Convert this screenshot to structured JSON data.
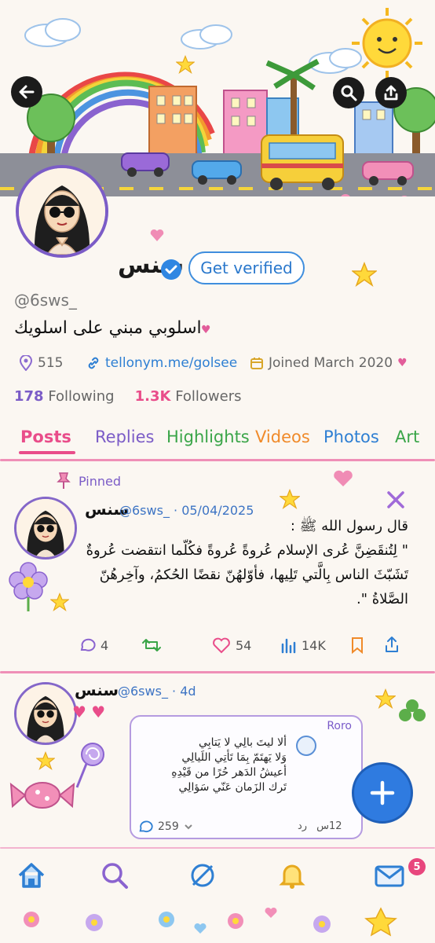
{
  "profile": {
    "display_name": "سنس",
    "get_verified_label": "Get verified",
    "handle": "@6sws_",
    "bio": "اسلوبي مبني على اسلويك",
    "location": "515",
    "website": "tellonym.me/golsee",
    "joined": "Joined March 2020",
    "following_count": "178",
    "following_label": "Following",
    "followers_count": "1.3K",
    "followers_label": "Followers"
  },
  "tabs": [
    {
      "label": "Posts",
      "color": "#e94d8a"
    },
    {
      "label": "Replies",
      "color": "#7b5cc7"
    },
    {
      "label": "Highlights",
      "color": "#3aa548"
    },
    {
      "label": "Videos",
      "color": "#f08a2a"
    },
    {
      "label": "Photos",
      "color": "#2e7fd3"
    },
    {
      "label": "Art",
      "color": "#3aa548"
    }
  ],
  "pinned_post": {
    "pinned_label": "Pinned",
    "name": "سنس",
    "handle_date": "@6sws_ · 05/04/2025",
    "lines": [
      "قال رسول الله ﷺ :",
      "\" لِتُنقَضِنَّ عُرى الإسلام عُروةً عُروةً فكُلّما انتقضت عُروةٌ",
      "تَشَبّثَ الناس بِالَّتي تَلِيها، فأوّلهُنّ نقضًا الحُكمُ، وآخِرهُنّ",
      "الصَّلاةُ \"."
    ],
    "stats": {
      "replies": "4",
      "likes": "54",
      "views": "14K"
    }
  },
  "second_post": {
    "name": "سنس",
    "handle_date": "@6sws_ · 4d",
    "quote": {
      "author": "Roro",
      "lines": [
        "ألا ليتَ بالِي لا يَتابِي",
        "وَلا يَهتَمّ بِمَا تَأتِي اللَيالِي",
        "أعيشُ الدَهر حُرًا من قَيْدِهِ",
        "تَرك الزَمان عَنّي سَؤالِي"
      ],
      "replies": "259",
      "time": "12س",
      "reply_label": "رد"
    }
  },
  "nav": {
    "badge_count": "5",
    "icons": [
      "home-icon",
      "search-icon",
      "grok-icon",
      "bell-icon",
      "mail-icon"
    ]
  },
  "colors": {
    "accent_pink": "#e94d8a",
    "accent_blue": "#2e7fd3",
    "accent_purple": "#7b5cc7",
    "page_bg": "#fbf7f2"
  }
}
